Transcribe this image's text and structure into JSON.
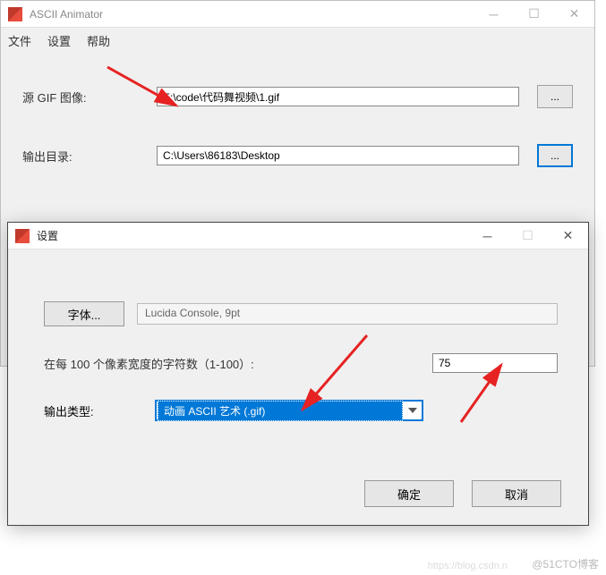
{
  "main": {
    "title": "ASCII Animator",
    "menu": {
      "file": "文件",
      "settings": "设置",
      "help": "帮助"
    },
    "source_label": "源 GIF 图像:",
    "source_value": "E:\\code\\代码舞视频\\1.gif",
    "output_label": "输出目录:",
    "output_value": "C:\\Users\\86183\\Desktop",
    "browse": "..."
  },
  "dialog": {
    "title": "设置",
    "font_button": "字体...",
    "font_display": "Lucida Console, 9pt",
    "density_label": "在每 100 个像素宽度的字符数（1-100）:",
    "density_value": "75",
    "output_type_label": "输出类型:",
    "output_type_selected": "动画 ASCII 艺术 (.gif)",
    "ok": "确定",
    "cancel": "取消"
  },
  "watermark": "@51CTO博客",
  "watermark2": "https://blog.csdn.n"
}
